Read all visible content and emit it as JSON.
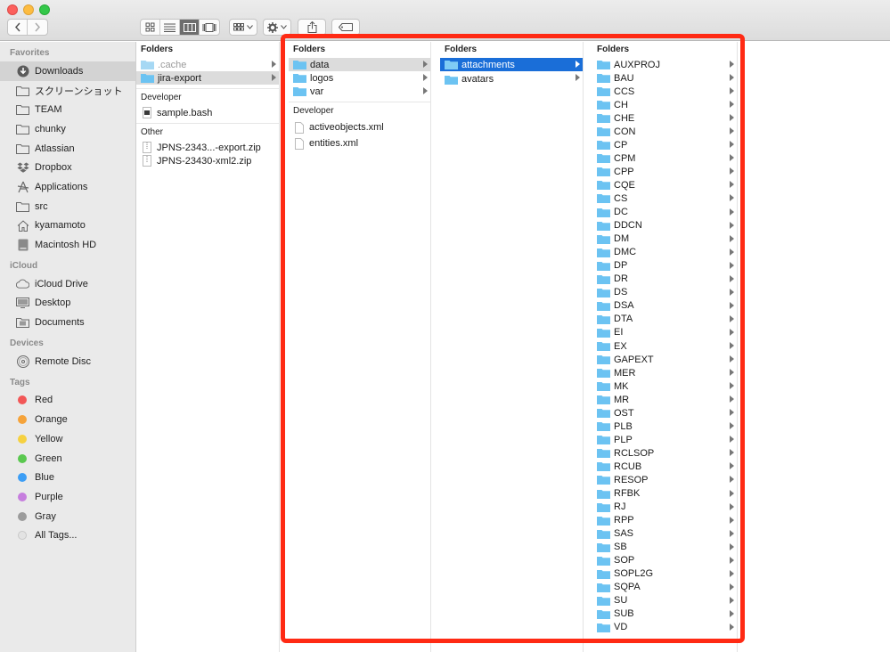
{
  "toolbar": {
    "back_icon": "chevron-left-icon",
    "forward_icon": "chevron-right-icon",
    "view_modes": [
      "icon-view",
      "list-view",
      "column-view",
      "gallery-view"
    ],
    "active_view": "column-view"
  },
  "sidebar": {
    "favorites_title": "Favorites",
    "favorites": [
      {
        "label": "Downloads",
        "icon": "download-icon",
        "selected": true
      },
      {
        "label": "スクリーンショット",
        "icon": "folder-icon"
      },
      {
        "label": "TEAM",
        "icon": "folder-icon"
      },
      {
        "label": "chunky",
        "icon": "folder-icon"
      },
      {
        "label": "Atlassian",
        "icon": "folder-icon"
      },
      {
        "label": "Dropbox",
        "icon": "dropbox-icon"
      },
      {
        "label": "Applications",
        "icon": "applications-icon"
      },
      {
        "label": "src",
        "icon": "folder-icon"
      },
      {
        "label": "kyamamoto",
        "icon": "home-icon"
      },
      {
        "label": "Macintosh HD",
        "icon": "hard-drive-icon"
      }
    ],
    "icloud_title": "iCloud",
    "icloud": [
      {
        "label": "iCloud Drive",
        "icon": "cloud-icon"
      },
      {
        "label": "Desktop",
        "icon": "desktop-icon"
      },
      {
        "label": "Documents",
        "icon": "documents-icon"
      }
    ],
    "devices_title": "Devices",
    "devices": [
      {
        "label": "Remote Disc",
        "icon": "disc-icon"
      }
    ],
    "tags_title": "Tags",
    "tags": [
      {
        "label": "Red",
        "color": "#f25757"
      },
      {
        "label": "Orange",
        "color": "#f5a33a"
      },
      {
        "label": "Yellow",
        "color": "#f6d140"
      },
      {
        "label": "Green",
        "color": "#5ac84f"
      },
      {
        "label": "Blue",
        "color": "#3d9ef5"
      },
      {
        "label": "Purple",
        "color": "#c67ede"
      },
      {
        "label": "Gray",
        "color": "#9b9b9b"
      },
      {
        "label": "All Tags...",
        "color": "#e3e3e3"
      }
    ]
  },
  "column1": {
    "folders_title": "Folders",
    "folders": [
      {
        "label": ".cache",
        "dim": true
      },
      {
        "label": "jira-export",
        "highlight": true
      }
    ],
    "developer_title": "Developer",
    "developer": [
      {
        "label": "sample.bash"
      }
    ],
    "other_title": "Other",
    "other": [
      {
        "label": "JPNS-2343...-export.zip"
      },
      {
        "label": "JPNS-23430-xml2.zip"
      }
    ]
  },
  "column2": {
    "folders_title": "Folders",
    "folders": [
      {
        "label": "data",
        "highlight": true
      },
      {
        "label": "logos"
      },
      {
        "label": "var"
      }
    ],
    "developer_title": "Developer",
    "developer": [
      {
        "label": "activeobjects.xml"
      },
      {
        "label": "entities.xml"
      }
    ]
  },
  "column3": {
    "folders_title": "Folders",
    "folders": [
      {
        "label": "attachments",
        "selected": true
      },
      {
        "label": "avatars"
      }
    ]
  },
  "column4": {
    "folders_title": "Folders",
    "folders": [
      "AUXPROJ",
      "BAU",
      "CCS",
      "CH",
      "CHE",
      "CON",
      "CP",
      "CPM",
      "CPP",
      "CQE",
      "CS",
      "DC",
      "DDCN",
      "DM",
      "DMC",
      "DP",
      "DR",
      "DS",
      "DSA",
      "DTA",
      "EI",
      "EX",
      "GAPEXT",
      "MER",
      "MK",
      "MR",
      "OST",
      "PLB",
      "PLP",
      "RCLSOP",
      "RCUB",
      "RESOP",
      "RFBK",
      "RJ",
      "RPP",
      "SAS",
      "SB",
      "SOP",
      "SOPL2G",
      "SQPA",
      "SU",
      "SUB",
      "VD"
    ]
  },
  "colors": {
    "selection": "#1a6ed8",
    "annotation": "#ff2a14",
    "folder_blue": "#6cc3f2"
  }
}
